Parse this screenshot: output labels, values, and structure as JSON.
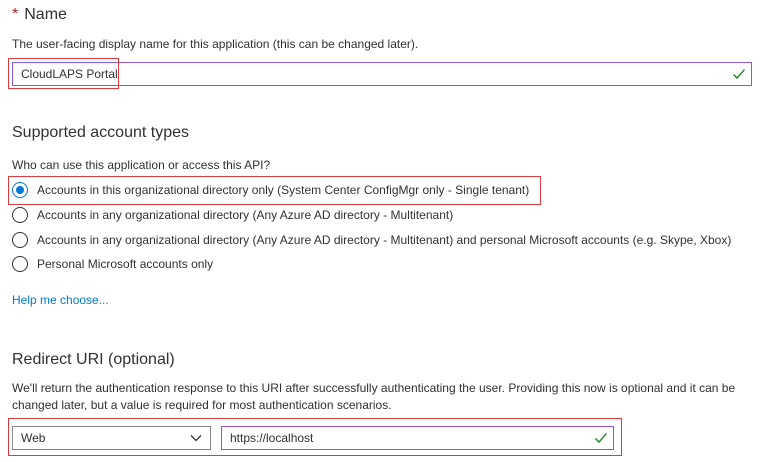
{
  "name_section": {
    "required_marker": "*",
    "title": "Name",
    "description": "The user-facing display name for this application (this can be changed later).",
    "input_value": "CloudLAPS Portal"
  },
  "account_types": {
    "title": "Supported account types",
    "question": "Who can use this application or access this API?",
    "options": [
      {
        "label": "Accounts in this organizational directory only (System Center ConfigMgr only - Single tenant)",
        "selected": true
      },
      {
        "label": "Accounts in any organizational directory (Any Azure AD directory - Multitenant)",
        "selected": false
      },
      {
        "label": "Accounts in any organizational directory (Any Azure AD directory - Multitenant) and personal Microsoft accounts (e.g. Skype, Xbox)",
        "selected": false
      },
      {
        "label": "Personal Microsoft accounts only",
        "selected": false
      }
    ],
    "help_link": "Help me choose..."
  },
  "redirect_section": {
    "title": "Redirect URI (optional)",
    "description": "We'll return the authentication response to this URI after successfully authenticating the user. Providing this now is optional and it can be changed later, but a value is required for most authentication scenarios.",
    "platform_value": "Web",
    "uri_value": "https://localhost"
  },
  "colors": {
    "accent": "#0078d4",
    "highlight": "#e0393e",
    "input_border": "#8a57d8",
    "valid_check": "#107c10"
  },
  "icons": {
    "valid": "checkmark-icon",
    "dropdown": "chevron-down-icon",
    "selected_radio": "radio-checked",
    "unselected_radio": "radio-unchecked"
  }
}
